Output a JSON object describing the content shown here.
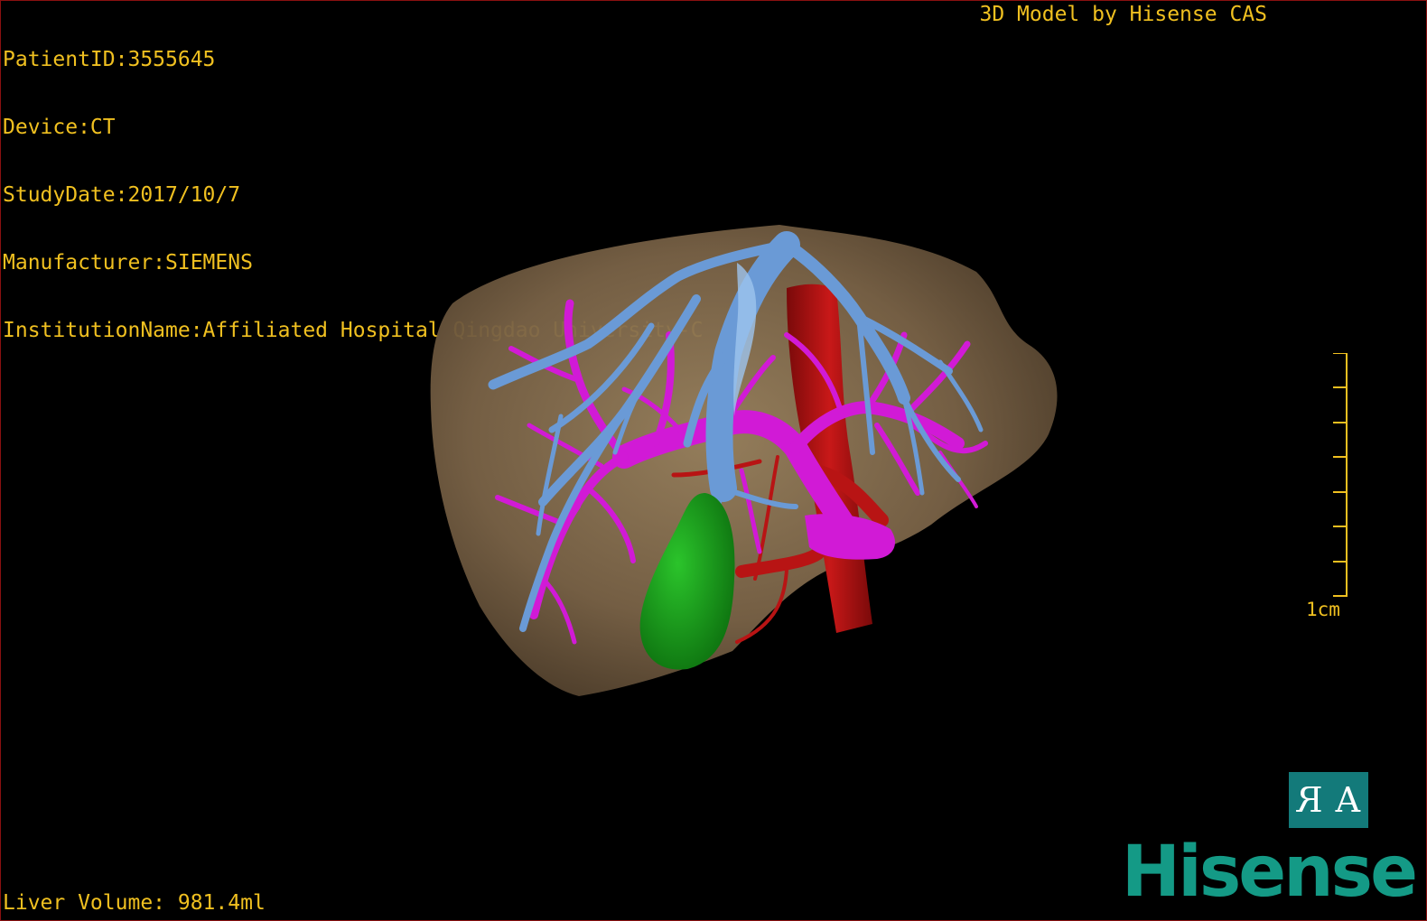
{
  "patient_info": {
    "patient_id": "PatientID:3555645",
    "device": "Device:CT",
    "study_date": "StudyDate:2017/10/7",
    "manufacturer": "Manufacturer:SIEMENS",
    "institution": "InstitutionName:Affiliated Hospital Qingdao University-C"
  },
  "brand_caption": "3D Model by Hisense CAS",
  "liver_volume": "Liver Volume: 981.4ml",
  "scale": {
    "label": "1cm",
    "tick_count": 8
  },
  "orientation_button": {
    "left": "R",
    "right": "A"
  },
  "logo": "Hisense",
  "colors": {
    "overlay_text": "#f0c020",
    "liver": "#7a6347",
    "portal_vein": "#d11ad6",
    "hepatic_vein": "#6a9ad6",
    "artery_ivc": "#b81414",
    "gallbladder": "#169a1a",
    "logo": "#149a86",
    "button": "#137a7a"
  },
  "icons": [
    "orientation-icon"
  ]
}
